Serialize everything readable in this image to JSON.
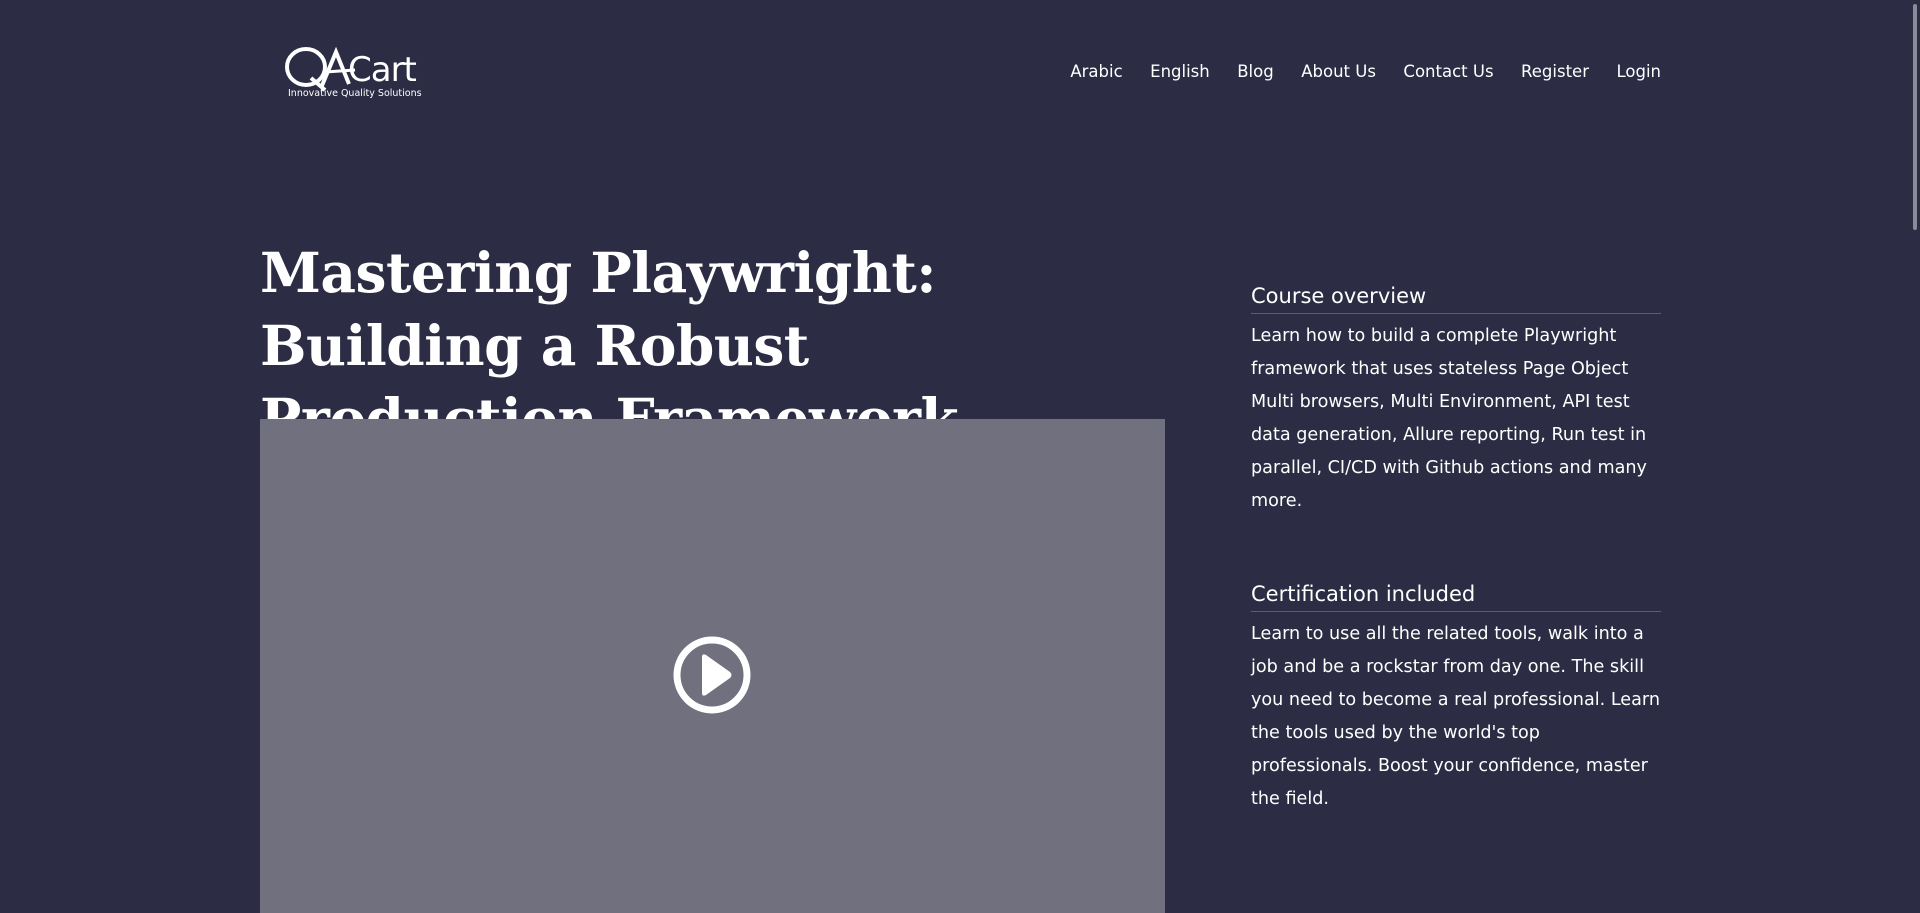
{
  "header": {
    "logo_text": "QACart",
    "logo_tagline": "Innovative Quality Solutions",
    "nav": [
      "Arabic",
      "English",
      "Blog",
      "About Us",
      "Contact Us",
      "Register",
      "Login"
    ]
  },
  "main": {
    "title": "Mastering Playwright: Building a Robust Production Framework",
    "video": {
      "play_icon": "play-circle-icon",
      "background": "#70707f"
    }
  },
  "sidebar": {
    "sections": [
      {
        "heading": "Course overview",
        "body": "Learn how to build a complete Playwright framework that uses stateless Page Object Multi browsers, Multi Environment, API test data generation, Allure reporting, Run test in parallel, CI/CD with Github actions and many more."
      },
      {
        "heading": "Certification included",
        "body": "Learn to use all the related tools, walk into a job and be a rockstar from day one. The skill you need to become a real professional. Learn the tools used by the world's top professionals. Boost your confidence, master the field."
      }
    ]
  },
  "colors": {
    "background": "#2c2c44",
    "text": "#ffffff",
    "video_placeholder": "#70707f"
  }
}
